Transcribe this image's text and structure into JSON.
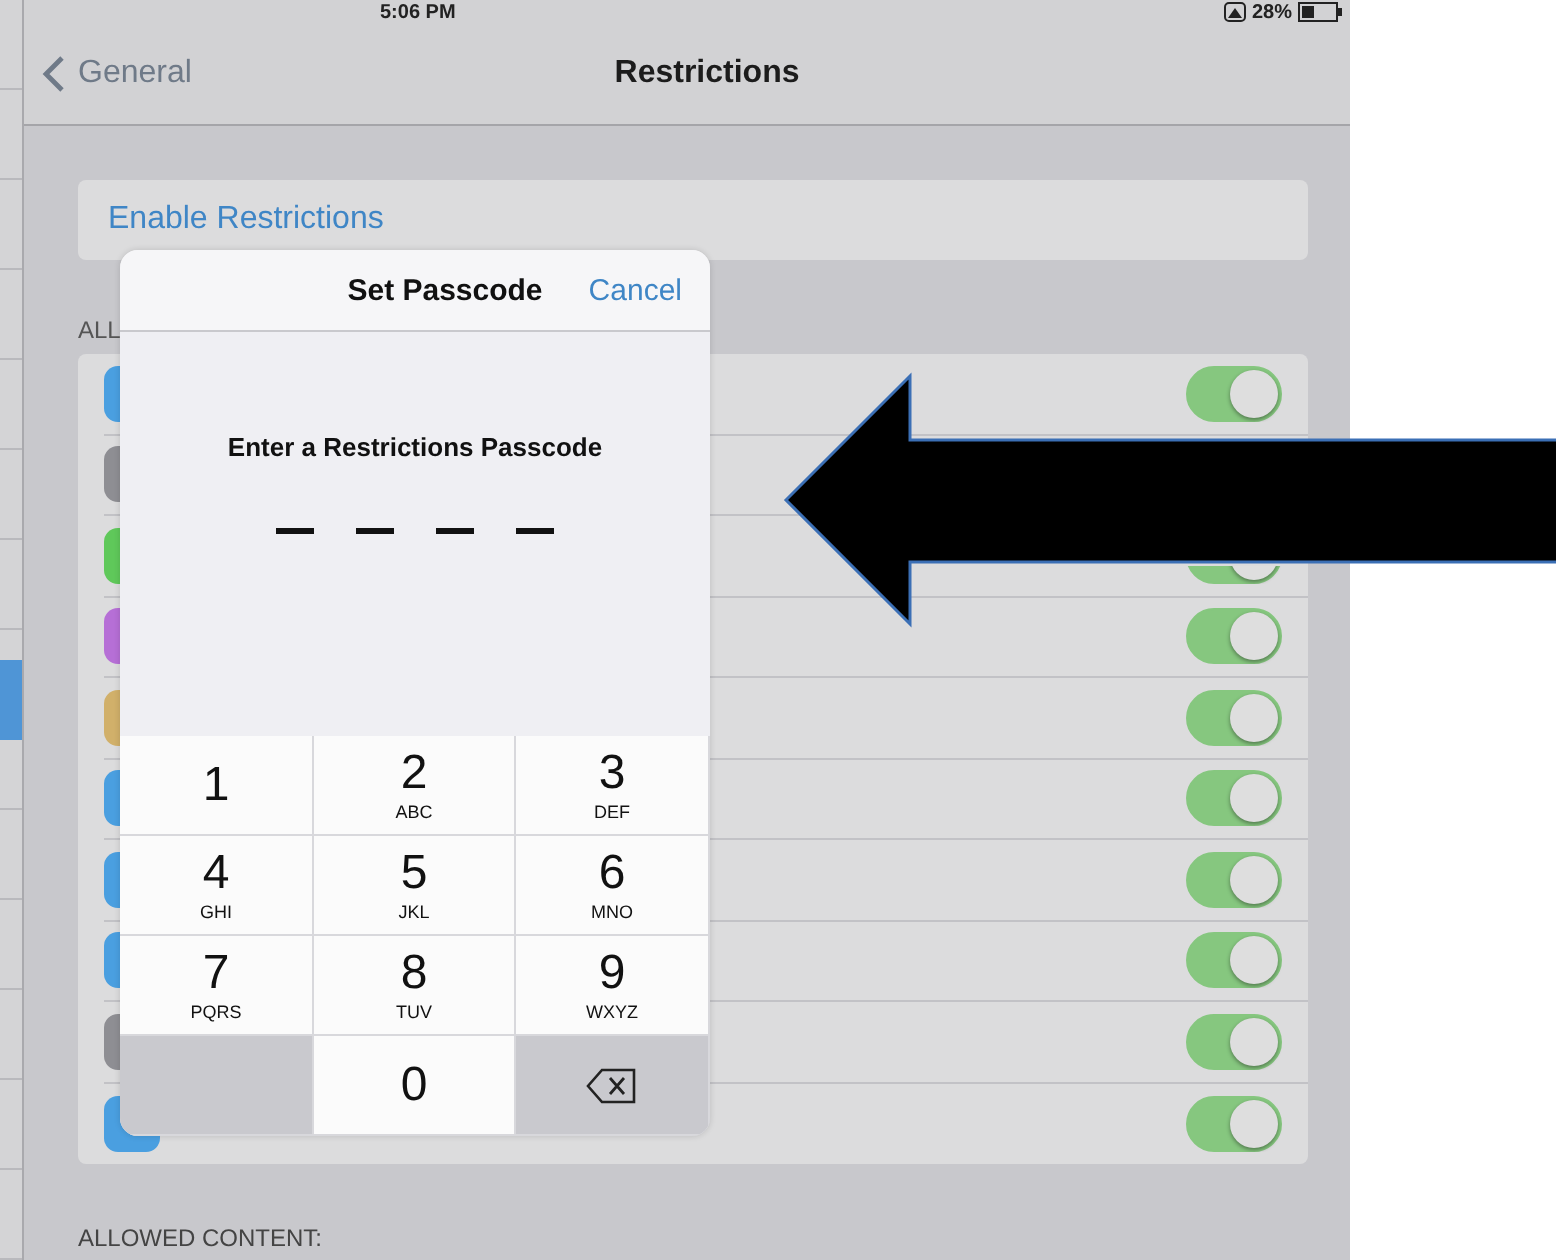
{
  "status_bar": {
    "time": "5:06 PM",
    "battery": "28%"
  },
  "nav_bar": {
    "back": "General",
    "title": "Restrictions"
  },
  "enable_restrictions": "Enable Restrictions",
  "allow_section": {
    "header": "ALL",
    "rows": [
      {
        "color": "#4a9fe0",
        "on": true
      },
      {
        "color": "#8e8e93"
      },
      {
        "color": "#5fc85a",
        "on": true
      },
      {
        "color": "#b66fd6",
        "on": true
      },
      {
        "color": "#d1b06a",
        "on": true
      },
      {
        "color": "#4a9fe0",
        "on": true
      },
      {
        "color": "#4a9fe0",
        "on": true
      },
      {
        "color": "#4a9fe0",
        "on": true
      },
      {
        "color": "#8e8e93",
        "on": true
      },
      {
        "color": "#4a9fe0",
        "on": true
      }
    ]
  },
  "allowed_content_header": "ALLOWED CONTENT:",
  "passcode_dialog": {
    "title": "Set Passcode",
    "cancel": "Cancel",
    "prompt": "Enter a Restrictions Passcode",
    "keys": [
      {
        "kind": "digit",
        "digit": "1"
      },
      {
        "kind": "digit",
        "digit": "2",
        "letters": "ABC"
      },
      {
        "kind": "digit",
        "digit": "3",
        "letters": "DEF"
      },
      {
        "kind": "digit",
        "digit": "4",
        "letters": "GHI"
      },
      {
        "kind": "digit",
        "digit": "5",
        "letters": "JKL"
      },
      {
        "kind": "digit",
        "digit": "6",
        "letters": "MNO"
      },
      {
        "kind": "digit",
        "digit": "7",
        "letters": "PQRS"
      },
      {
        "kind": "digit",
        "digit": "8",
        "letters": "TUV"
      },
      {
        "kind": "digit",
        "digit": "9",
        "letters": "WXYZ"
      },
      {
        "kind": "blank"
      },
      {
        "kind": "digit",
        "digit": "0"
      },
      {
        "kind": "delete"
      }
    ]
  }
}
